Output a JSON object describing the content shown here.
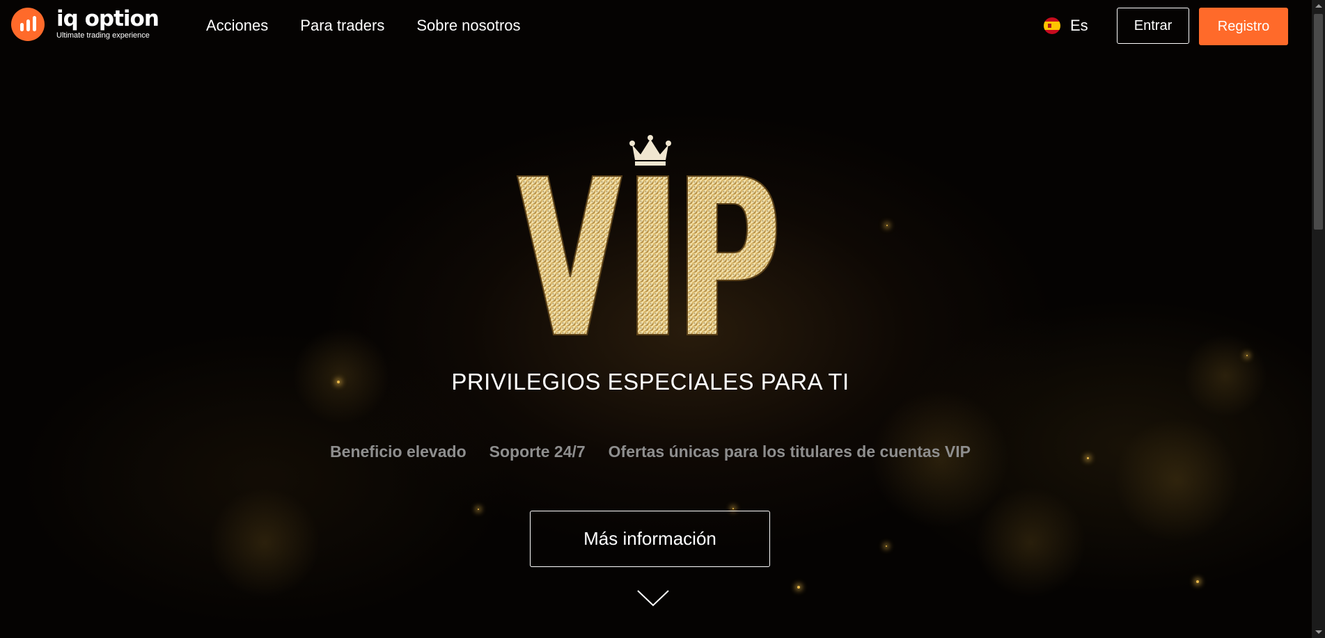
{
  "header": {
    "logo": {
      "name": "iq option",
      "tagline": "Ultimate trading experience"
    },
    "nav": [
      {
        "label": "Acciones"
      },
      {
        "label": "Para traders"
      },
      {
        "label": "Sobre nosotros"
      }
    ],
    "language": {
      "label": "Es",
      "icon": "spain-flag-icon"
    },
    "login_label": "Entrar",
    "register_label": "Registro"
  },
  "hero": {
    "logo_text": "VIP",
    "tagline": "PRIVILEGIOS ESPECIALES PARA TI",
    "features": [
      "Beneficio elevado",
      "Soporte 24/7",
      "Ofertas únicas para los titulares de cuentas VIP"
    ],
    "more_label": "Más información",
    "scroll_icon": "chevron-down-icon"
  },
  "colors": {
    "accent": "#ff6a2a",
    "gold": "#d4b062",
    "feature_text": "#8e8e8e",
    "background": "#050302"
  }
}
